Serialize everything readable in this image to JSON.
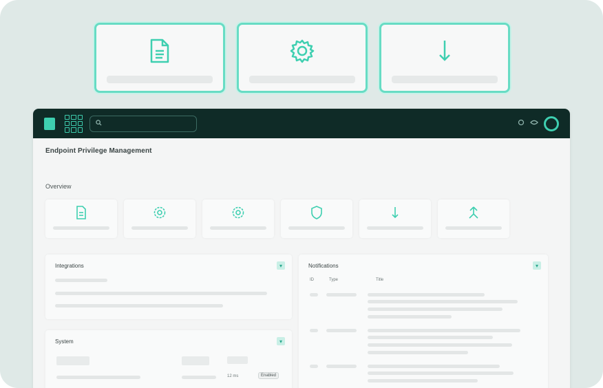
{
  "float_cards": [
    {
      "icon": "document-icon"
    },
    {
      "icon": "gear-icon"
    },
    {
      "icon": "download-arrow-icon"
    }
  ],
  "topbar": {
    "search_placeholder": ""
  },
  "page": {
    "title": "Endpoint Privilege Management",
    "overview_label": "Overview"
  },
  "overview_cards": [
    {
      "icon": "document-icon"
    },
    {
      "icon": "gear-icon"
    },
    {
      "icon": "gear-icon"
    },
    {
      "icon": "shield-icon"
    },
    {
      "icon": "download-arrow-icon"
    },
    {
      "icon": "user-arrow-icon"
    }
  ],
  "panels": {
    "left_top_title": "Integrations",
    "left_bottom_title": "System",
    "right_title": "Notifications",
    "right_col_id": "ID",
    "right_col_a": "Type",
    "right_col_b": "Title",
    "left_bottom_col_value": "12 ms",
    "left_bottom_badge": "Enabled"
  },
  "colors": {
    "accent": "#3ecfb0",
    "topbar": "#0f2b27",
    "frame_bg": "#dfe9e7"
  }
}
